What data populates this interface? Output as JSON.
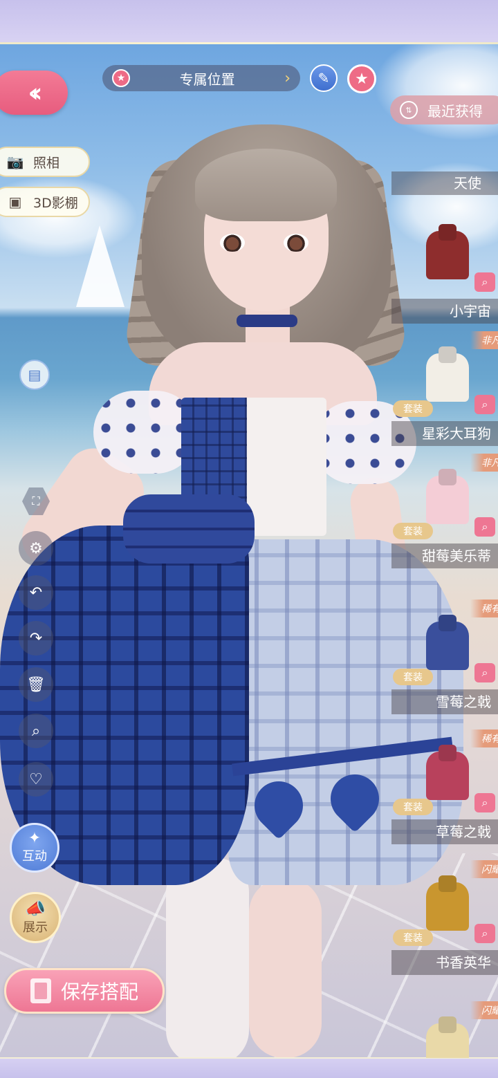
{
  "top_bar": {
    "position_label": "专属位置",
    "star_icon": "star-icon",
    "arrow_icon": "chevron-right-icon",
    "edit_icon": "pencil-icon",
    "favorite_icon": "star-icon"
  },
  "left_tools": {
    "back_icon": "double-chevron-left-icon",
    "photo_label": "照相",
    "studio_label": "3D影棚",
    "icons": [
      "bag-icon",
      "fullscreen-icon",
      "gear-icon",
      "undo-icon",
      "redo-icon",
      "trash-icon",
      "search-icon",
      "heart-icon"
    ],
    "interact_label": "互动",
    "show_label": "展示",
    "save_label": "保存搭配"
  },
  "right_panel": {
    "sort_label": "最近获得",
    "items": [
      {
        "name": "天使",
        "badge": "",
        "set": ""
      },
      {
        "name": "小宇宙",
        "badge": "",
        "set": ""
      },
      {
        "name": "星彩大耳狗",
        "badge": "非凡",
        "set": "套装"
      },
      {
        "name": "甜莓美乐蒂",
        "badge": "非凡",
        "set": "套装"
      },
      {
        "name": "雪莓之戟",
        "badge": "稀有",
        "set": "套装"
      },
      {
        "name": "草莓之戟",
        "badge": "稀有",
        "set": "套装"
      },
      {
        "name": "书香英华",
        "badge": "闪耀",
        "set": "套装"
      },
      {
        "name": "",
        "badge": "闪耀",
        "set": ""
      }
    ]
  },
  "colors": {
    "accent_pink": "#ee6b86",
    "accent_blue": "#4f7bd6",
    "gold": "#e7c78c"
  }
}
